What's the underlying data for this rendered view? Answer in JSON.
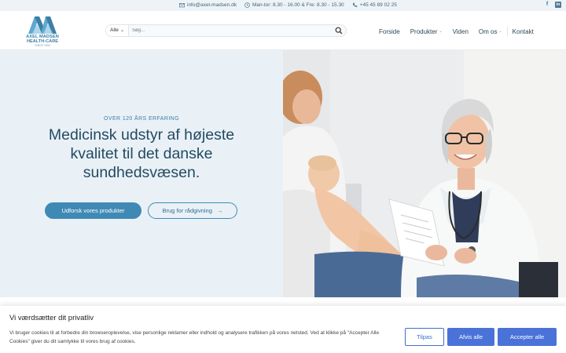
{
  "topbar": {
    "email": "info@axel-madsen.dk",
    "hours": "Man-tor: 8.30 - 16.00 & Fre: 8.30 - 15.30",
    "phone": "+45 45 89 02 25",
    "social": [
      "facebook-icon",
      "linkedin-icon"
    ]
  },
  "logo": {
    "line1": "AXEL MADSEN",
    "line2": "HEALTH-CARE",
    "line3": "SINCE 1904"
  },
  "search": {
    "category": "Alle",
    "placeholder": "Søg..."
  },
  "nav": {
    "items": [
      {
        "label": "Forside"
      },
      {
        "label": "Produkter"
      },
      {
        "label": "Viden"
      },
      {
        "label": "Om os"
      },
      {
        "label": "Kontakt"
      }
    ]
  },
  "hero": {
    "eyebrow": "OVER 120 ÅRS ERFARING",
    "headline": "Medicinsk udstyr af højeste kvalitet til det danske sundhedsvæsen.",
    "primary_button": "Udforsk vores produkter",
    "secondary_button": "Brug for rådgivning",
    "secondary_arrow": "→"
  },
  "cookie": {
    "title": "Vi værdsætter dit privatliv",
    "text": "Vi bruger cookies til at forbedre din browseroplevelse, vise personlige reklamer eller indhold og analysere trafikken på vores netsted. Ved at klikke på \"Accepter Alle Cookies\" giver du dit samtykke til vores brug af cookies.",
    "buttons": {
      "customize": "Tilpas",
      "reject": "Afvis alle",
      "accept": "Accepter alle"
    }
  },
  "colors": {
    "accent": "#3f8ab5",
    "headline": "#244b61",
    "hero_bg": "#e9f1f7",
    "cookie_button": "#4a72d8"
  }
}
